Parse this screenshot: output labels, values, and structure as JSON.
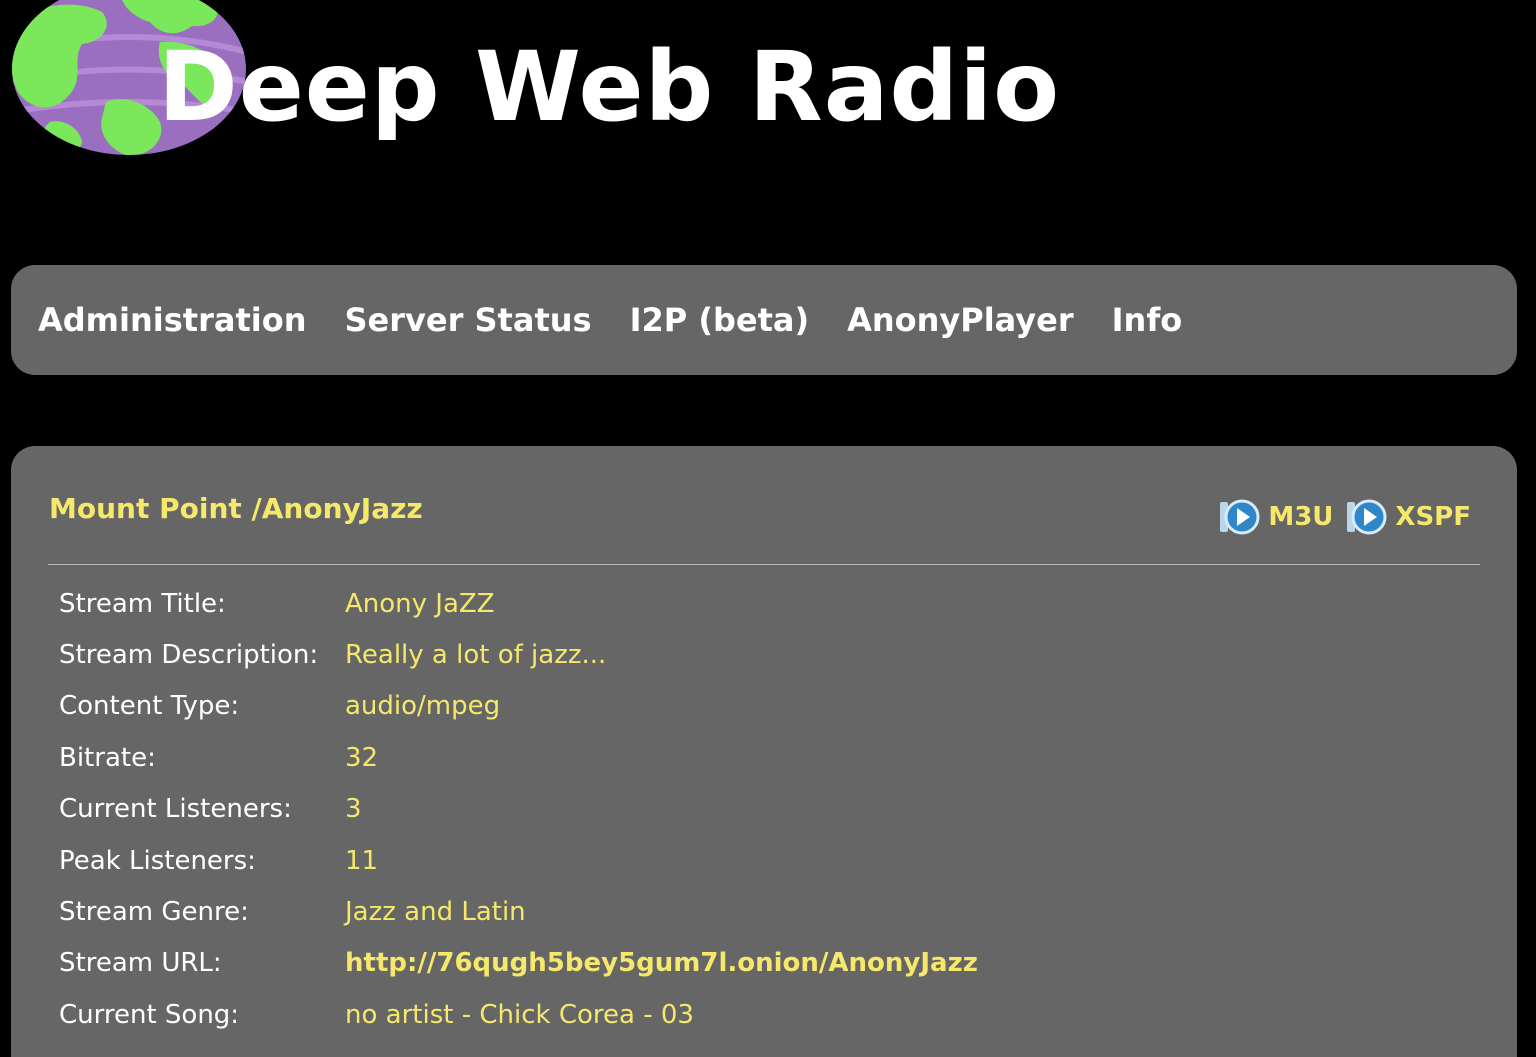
{
  "site": {
    "title": "Deep Web Radio"
  },
  "nav": {
    "items": [
      {
        "label": "Administration"
      },
      {
        "label": "Server Status"
      },
      {
        "label": "I2P (beta)"
      },
      {
        "label": "AnonyPlayer"
      },
      {
        "label": "Info"
      }
    ]
  },
  "mount": {
    "title": "Mount Point /AnonyJazz",
    "playlists": [
      {
        "label": "M3U",
        "icon": "play-icon"
      },
      {
        "label": "XSPF",
        "icon": "play-icon"
      }
    ],
    "fields": [
      {
        "label": "Stream Title:",
        "value": "Anony JaZZ"
      },
      {
        "label": "Stream Description:",
        "value": "Really a lot of jazz..."
      },
      {
        "label": "Content Type:",
        "value": "audio/mpeg"
      },
      {
        "label": "Bitrate:",
        "value": "32"
      },
      {
        "label": "Current Listeners:",
        "value": "3"
      },
      {
        "label": "Peak Listeners:",
        "value": "11"
      },
      {
        "label": "Stream Genre:",
        "value": "Jazz and Latin"
      },
      {
        "label": "Stream URL:",
        "value": "http://76qugh5bey5gum7l.onion/AnonyJazz"
      },
      {
        "label": "Current Song:",
        "value": "no artist - Chick Corea - 03"
      }
    ]
  },
  "colors": {
    "background": "#000000",
    "panel": "#666666",
    "accent_text": "#f5e86a",
    "logo_globe": "#9b6fc0",
    "logo_land": "#7ae85a"
  }
}
